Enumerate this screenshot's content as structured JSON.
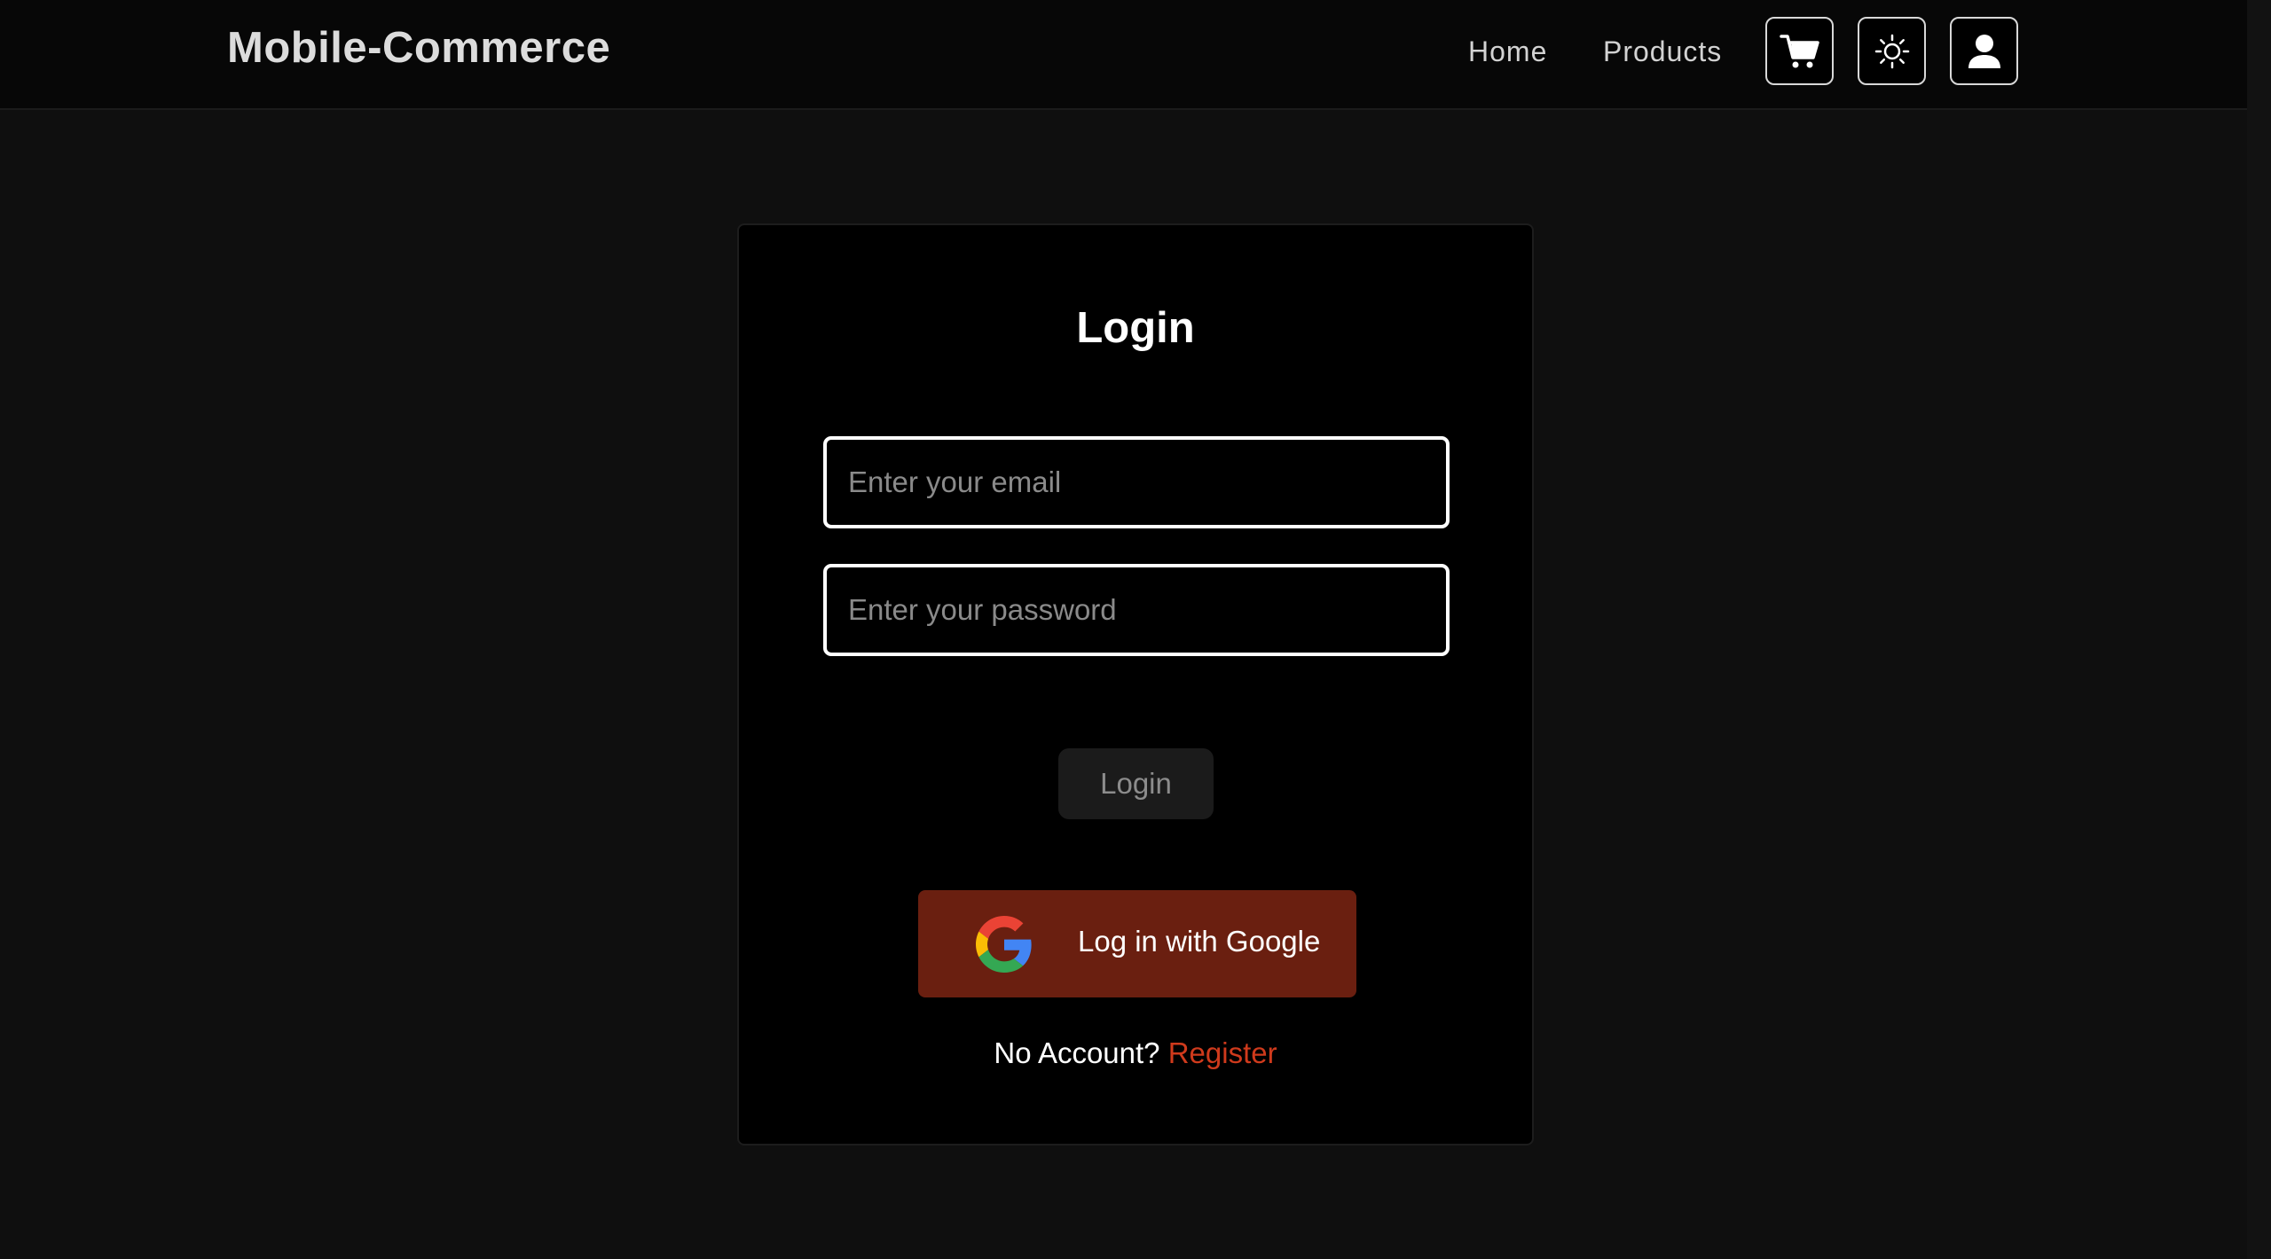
{
  "header": {
    "brand": "Mobile-Commerce",
    "nav": {
      "home_label": "Home",
      "products_label": "Products"
    },
    "icons": {
      "cart": "cart-icon",
      "theme": "sun-icon",
      "user": "user-icon"
    }
  },
  "login_card": {
    "title": "Login",
    "email": {
      "value": "",
      "placeholder": "Enter your email"
    },
    "password": {
      "value": "",
      "placeholder": "Enter your password"
    },
    "submit_label": "Login",
    "google_button": {
      "label": "Log in with Google",
      "icon": "google-icon"
    },
    "register_prompt": {
      "text": "No Account?",
      "link_label": "Register"
    }
  },
  "colors": {
    "page_background": "#0f0f0f",
    "navbar_background": "#070707",
    "card_background": "#000000",
    "google_button": "#6a1f10",
    "register_link": "#cf3a1c",
    "login_button_disabled": "#1b1b1b"
  }
}
